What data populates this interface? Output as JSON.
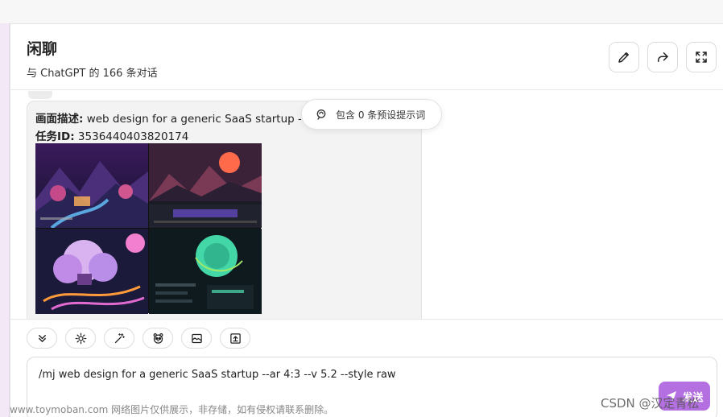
{
  "header": {
    "title": "闲聊",
    "subtitle": "与 ChatGPT 的 166 条对话",
    "buttons": [
      {
        "icon": "pencil-icon",
        "name": "edit-button"
      },
      {
        "icon": "share-icon",
        "name": "share-button"
      },
      {
        "icon": "fullscreen-icon",
        "name": "fullscreen-button"
      }
    ]
  },
  "message": {
    "desc_label": "画面描述:",
    "desc_value": " web design for a generic SaaS startup --ar 4:3 --v 5.2 --style raw",
    "task_label": "任务ID:",
    "task_value": " 3536440403820174"
  },
  "preset_pill": {
    "label": "包含 0 条预设提示词",
    "icon": "prompt-icon"
  },
  "toolbar": {
    "tools": [
      {
        "name": "collapse-tool",
        "icon": "double-chevron-down-icon"
      },
      {
        "name": "theme-tool",
        "icon": "sun-icon"
      },
      {
        "name": "magic-tool",
        "icon": "magic-wand-icon"
      },
      {
        "name": "mask-tool",
        "icon": "panda-mask-icon"
      },
      {
        "name": "image-tool",
        "icon": "image-icon"
      },
      {
        "name": "upload-tool",
        "icon": "upload-icon"
      }
    ]
  },
  "input": {
    "value": "/mj web design for a generic SaaS startup --ar 4:3 --v 5.2 --style raw"
  },
  "send": {
    "label": "发送"
  },
  "overlay": {
    "watermark": "www.toymoban.com 网络图片仅供展示，非存储，如有侵权请联系删除。",
    "csdn": "CSDN @汉定青松"
  },
  "colors": {
    "accent": "#b46fe0",
    "bubble": "#f3f3f3"
  }
}
